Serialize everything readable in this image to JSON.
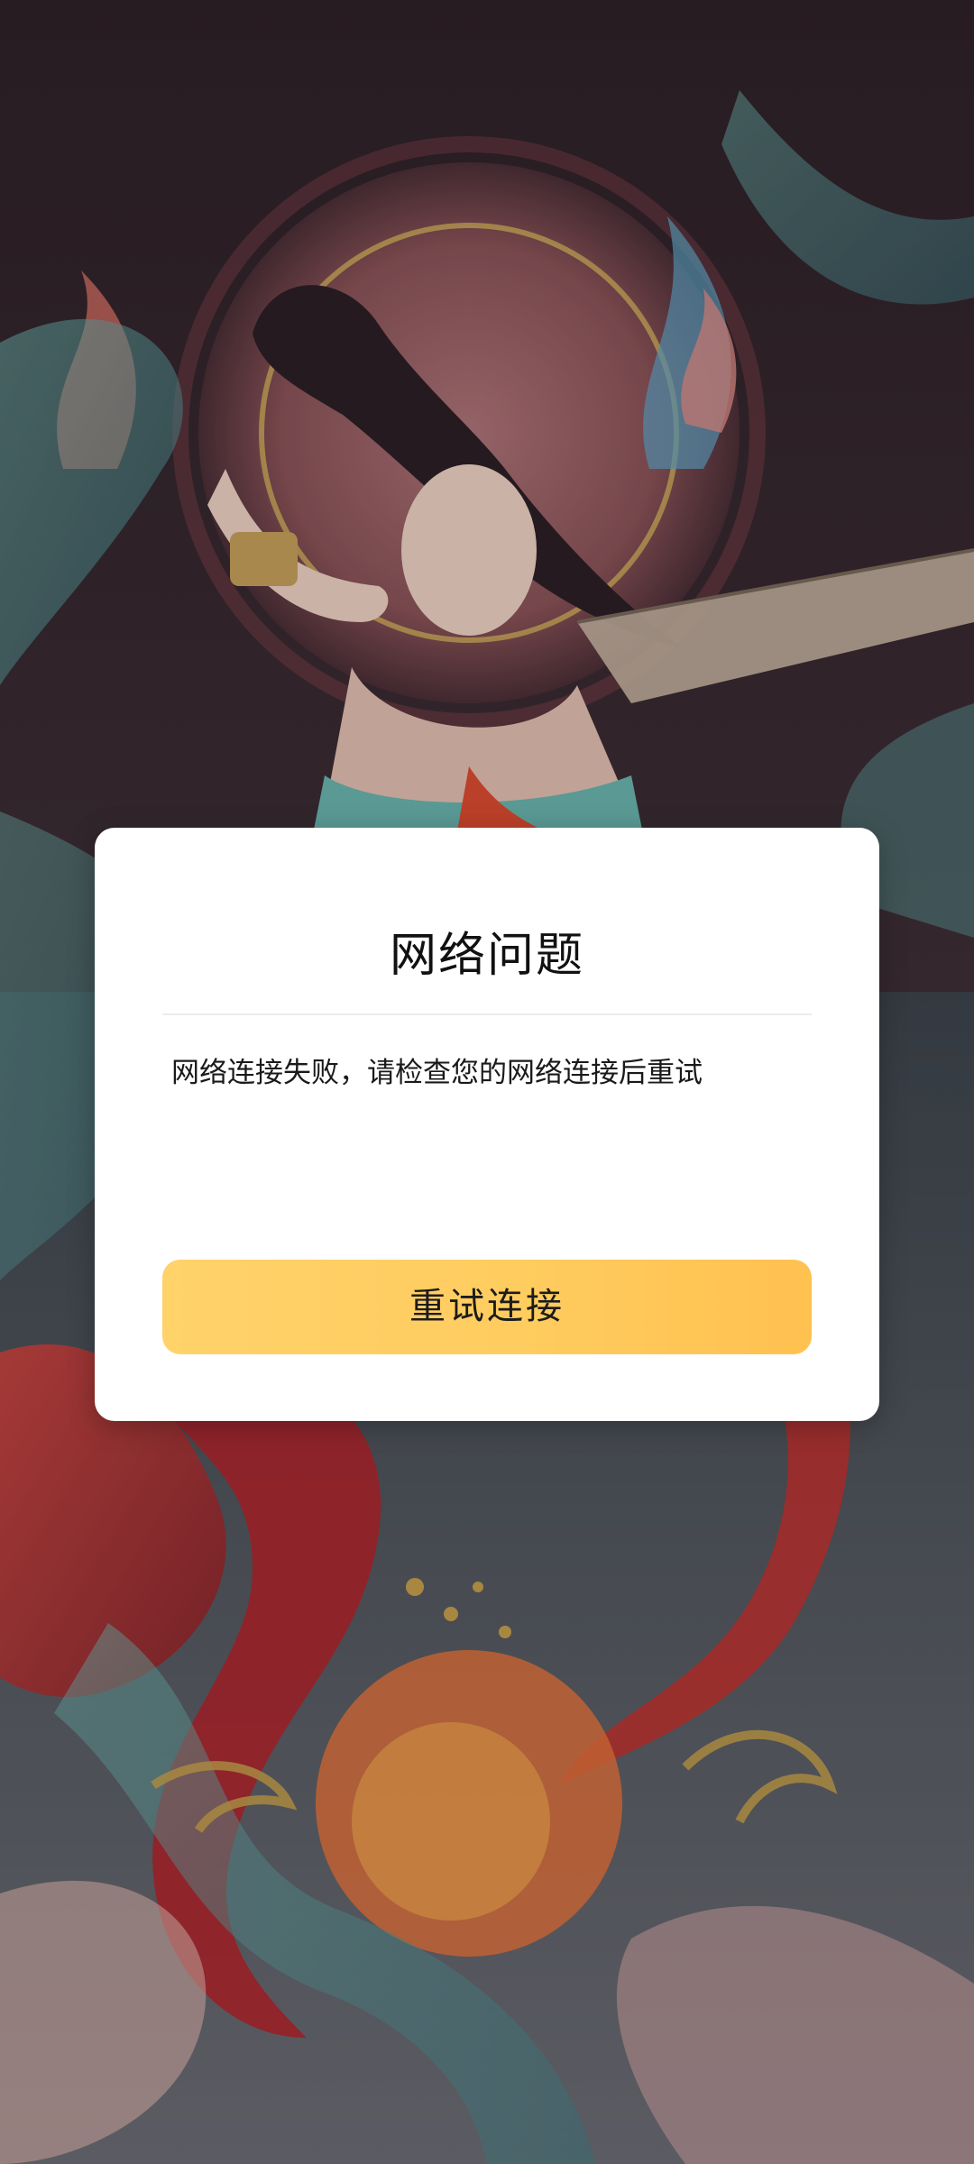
{
  "dialog": {
    "title": "网络问题",
    "message": "网络连接失败，请检查您的网络连接后重试",
    "retry_button_label": "重试连接"
  },
  "colors": {
    "dialog_background": "#ffffff",
    "button_gradient_start": "#ffd26a",
    "button_gradient_end": "#ffc150",
    "title_text": "#111111"
  },
  "background": {
    "description_icon": "artwork-background"
  }
}
